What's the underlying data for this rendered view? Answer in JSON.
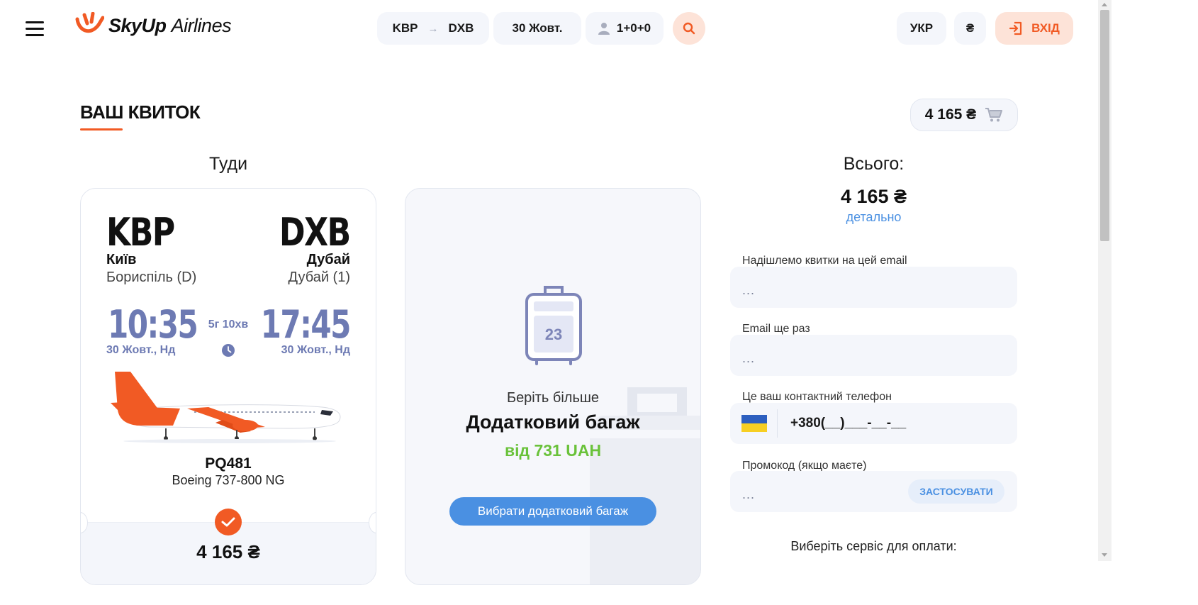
{
  "header": {
    "logo_bold": "SkyUp",
    "logo_light": "Airlines",
    "route_from": "KBP",
    "route_arrow": "→",
    "route_to": "DXB",
    "date": "30 Жовт.",
    "passengers": "1+0+0",
    "language": "УКР",
    "currency": "₴",
    "login_label": "ВХІД"
  },
  "page": {
    "title": "ВАШ КВИТОК",
    "cart_total": "4 165 ₴"
  },
  "flight": {
    "direction": "Туди",
    "from_code": "KBP",
    "from_city": "Київ",
    "from_airport": "Бориспіль (D)",
    "to_code": "DXB",
    "to_city": "Дубай",
    "to_airport": "Дубай (1)",
    "depart_time": "10:35",
    "depart_date": "30 Жовт., Нд",
    "arrive_time": "17:45",
    "arrive_date": "30 Жовт., Нд",
    "duration": "5г 10хв",
    "flight_number": "PQ481",
    "aircraft": "Boeing 737-800 NG",
    "price": "4 165 ₴"
  },
  "baggage": {
    "weight": "23",
    "subtitle": "Беріть більше",
    "title": "Додатковий багаж",
    "price": "від 731 UAH",
    "button": "Вибрати додатковий багаж"
  },
  "summary": {
    "total_label": "Всього:",
    "total_value": "4 165 ₴",
    "detail_link": "детально"
  },
  "form": {
    "email_label": "Надішлемо квитки на цей email",
    "email_placeholder": "...",
    "email_repeat_label": "Email ще раз",
    "email_repeat_placeholder": "...",
    "phone_label": "Це ваш контактний телефон",
    "phone_value": "+380(__)___-__-__",
    "promo_label": "Промокод (якщо маєте)",
    "promo_placeholder": "...",
    "promo_button": "ЗАСТОСУВАТИ",
    "payment_label": "Виберіть сервіс для оплати:"
  },
  "colors": {
    "brand_orange": "#f15a24",
    "accent_blue": "#4a90e2",
    "time_purple": "#6d7ab3",
    "price_green": "#6ac23a"
  }
}
